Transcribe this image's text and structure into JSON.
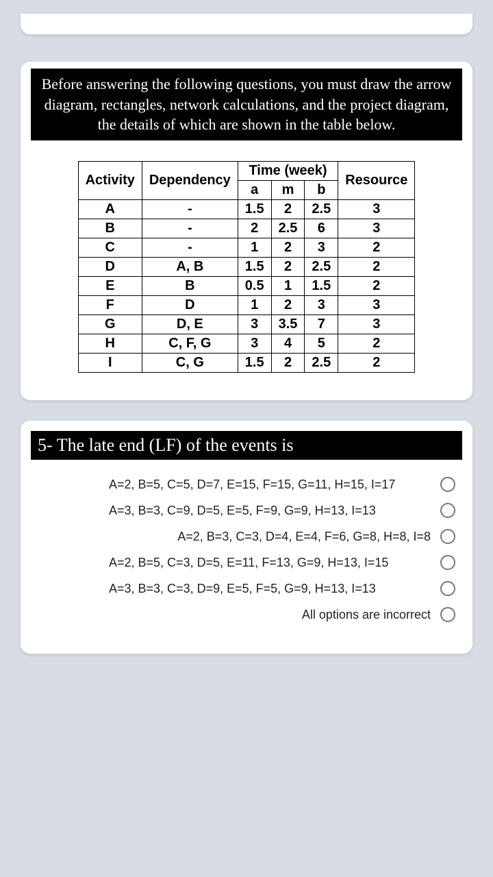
{
  "intro": "Before answering the following questions, you must draw the arrow diagram, rectangles, network calculations, and the project diagram, the details of which are shown in the table below.",
  "table": {
    "headers": {
      "activity": "Activity",
      "dependency": "Dependency",
      "time": "Time (week)",
      "a": "a",
      "m": "m",
      "b": "b",
      "resource": "Resource"
    },
    "rows": [
      {
        "activity": "A",
        "dependency": "-",
        "a": "1.5",
        "m": "2",
        "b": "2.5",
        "resource": "3"
      },
      {
        "activity": "B",
        "dependency": "-",
        "a": "2",
        "m": "2.5",
        "b": "6",
        "resource": "3"
      },
      {
        "activity": "C",
        "dependency": "-",
        "a": "1",
        "m": "2",
        "b": "3",
        "resource": "2"
      },
      {
        "activity": "D",
        "dependency": "A, B",
        "a": "1.5",
        "m": "2",
        "b": "2.5",
        "resource": "2"
      },
      {
        "activity": "E",
        "dependency": "B",
        "a": "0.5",
        "m": "1",
        "b": "1.5",
        "resource": "2"
      },
      {
        "activity": "F",
        "dependency": "D",
        "a": "1",
        "m": "2",
        "b": "3",
        "resource": "3"
      },
      {
        "activity": "G",
        "dependency": "D, E",
        "a": "3",
        "m": "3.5",
        "b": "7",
        "resource": "3"
      },
      {
        "activity": "H",
        "dependency": "C, F, G",
        "a": "3",
        "m": "4",
        "b": "5",
        "resource": "2"
      },
      {
        "activity": "I",
        "dependency": "C, G",
        "a": "1.5",
        "m": "2",
        "b": "2.5",
        "resource": "2"
      }
    ]
  },
  "question": {
    "title": "5- The late end (LF) of the events is",
    "options": [
      "A=2, B=5, C=5, D=7, E=15, F=15, G=11, H=15, I=17",
      "A=3, B=3, C=9, D=5, E=5, F=9, G=9, H=13, I=13",
      "A=2, B=3, C=3, D=4, E=4, F=6, G=8, H=8, I=8",
      "A=2, B=5, C=3, D=5, E=11, F=13, G=9, H=13, I=15",
      "A=3, B=3, C=3, D=9, E=5, F=5, G=9, H=13, I=13",
      "All options are incorrect"
    ]
  }
}
